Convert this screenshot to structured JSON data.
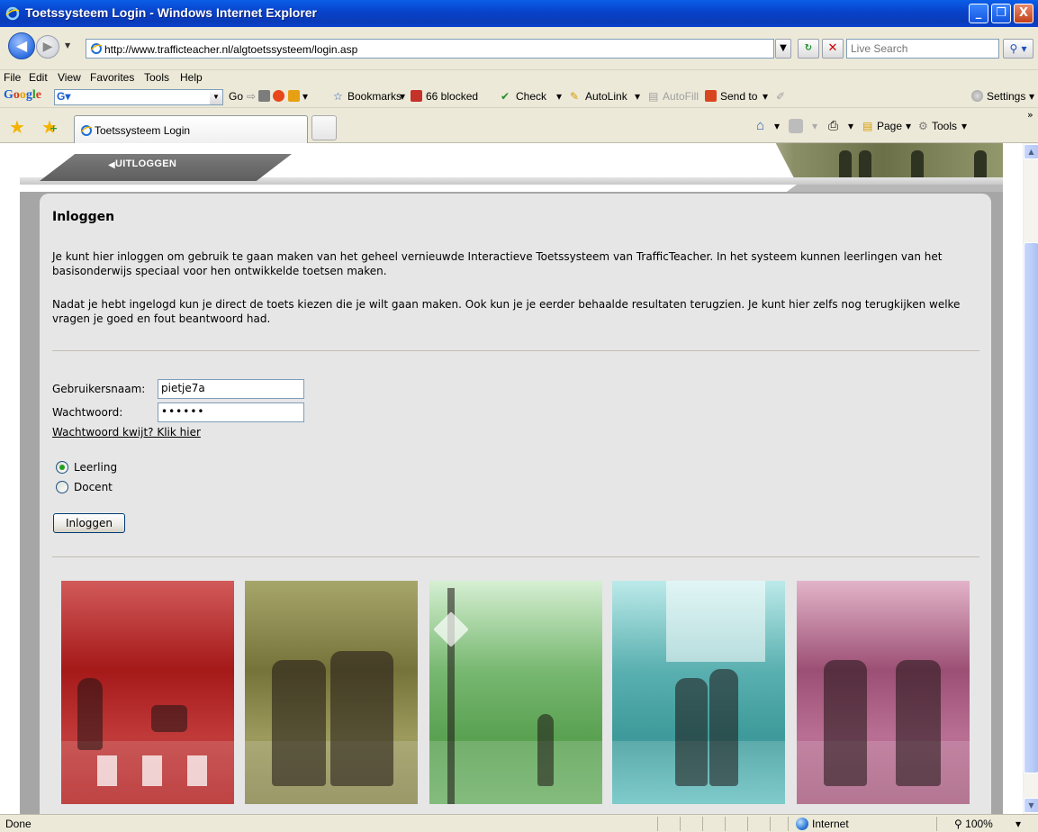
{
  "window": {
    "title": "Toetssysteem Login - Windows Internet Explorer",
    "min": "_",
    "max": "❐",
    "close": "X"
  },
  "address": {
    "url": "http://www.trafficteacher.nl/algtoetssysteem/login.asp",
    "search_placeholder": "Live Search"
  },
  "menu": [
    "File",
    "Edit",
    "View",
    "Favorites",
    "Tools",
    "Help"
  ],
  "google_toolbar": {
    "logo": "Google",
    "go": "Go",
    "bookmarks": "Bookmarks",
    "blocked": "66 blocked",
    "check": "Check",
    "autolink": "AutoLink",
    "autofill": "AutoFill",
    "sendto": "Send to",
    "settings": "Settings"
  },
  "tabs": {
    "active": "Toetssysteem Login"
  },
  "command_bar": {
    "page": "Page",
    "tools": "Tools"
  },
  "site": {
    "logout": "UITLOGGEN",
    "heading": "Inloggen",
    "intro1": "Je kunt hier inloggen om gebruik te gaan maken van het geheel vernieuwde Interactieve Toetssysteem van TrafficTeacher. In het systeem kunnen leerlingen van het basisonderwijs speciaal voor hen ontwikkelde toetsen maken.",
    "intro2": "Nadat je hebt ingelogd kun je direct de toets kiezen die je wilt gaan maken. Ook kun je je eerder behaalde resultaten terugzien. Je kunt hier zelfs nog terugkijken welke vragen je goed en fout beantwoord had.",
    "username_label": "Gebruikersnaam:",
    "username_value": "pietje7a",
    "password_label": "Wachtwoord:",
    "password_value": "••••••",
    "forgot": "Wachtwoord kwijt? Klik hier",
    "role_options": [
      "Leerling",
      "Docent"
    ],
    "role_selected": "Leerling",
    "login_button": "Inloggen"
  },
  "status": {
    "text": "Done",
    "zone": "Internet",
    "zoom": "100%"
  },
  "colors": {
    "titlebar": "#0842c9",
    "panel": "#e6e6e6",
    "radio_selected": "#21a121"
  }
}
